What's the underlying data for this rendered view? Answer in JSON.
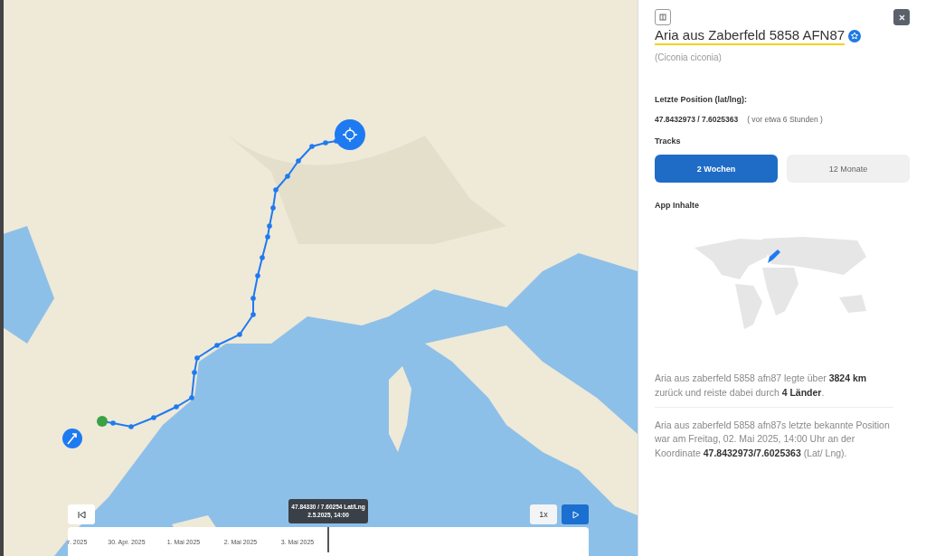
{
  "map": {
    "playback": {
      "speed": "1x",
      "tooltip_coords": "47.84330 / 7.60254 Lat/Lng",
      "tooltip_time": "2.5.2025, 14:00"
    },
    "timeline_labels": [
      "r. 2025",
      "30. Apr. 2025",
      "1. Mai 2025",
      "2. Mai 2025",
      "3. Mai 2025"
    ]
  },
  "panel": {
    "title": "Aria aus Zaberfeld 5858 AFN87",
    "scientific_name": "(Ciconia ciconia)",
    "last_position_label": "Letzte Position (lat/lng):",
    "last_position": "47.8432973 / 7.6025363",
    "last_position_age": "( vor etwa 6 Stunden )",
    "tracks_label": "Tracks",
    "tracks": [
      {
        "label": "2 Wochen",
        "selected": true
      },
      {
        "label": "12 Monate",
        "selected": false
      }
    ],
    "app_content_label": "App Inhalte",
    "summary": "Aria aus zaberfeld 5858 afn87 legte über **3824 km** zurück und reiste dabei durch **4 Länder**.",
    "last_known": "Aria aus zaberfeld 5858 afn87s letzte bekannte Position war am Freitag, 02. Mai 2025, 14:00 Uhr an der Koordinate **47.8432973/7.6025363** (Lat/ Lng)."
  }
}
